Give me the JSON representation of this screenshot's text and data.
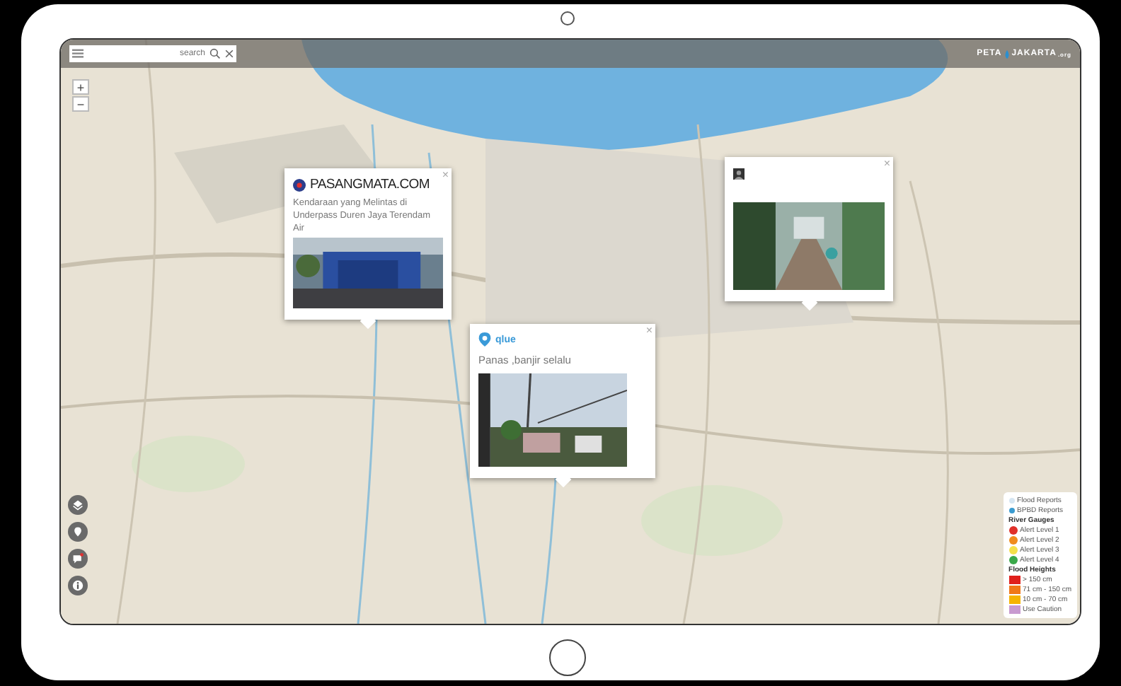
{
  "toolbar": {
    "search": {
      "placeholder": "search"
    },
    "brand": {
      "left": "PETA",
      "right": "JAKARTA",
      "suffix": ".org"
    }
  },
  "zoom": {
    "in": "+",
    "out": "−"
  },
  "popups": [
    {
      "kind": "pasangmata",
      "source": "PASANGMATA.COM",
      "text": "Kendaraan yang Melintas di Underpass Duren Jaya Terendam Air",
      "close": "×"
    },
    {
      "kind": "tweet",
      "close": "×"
    },
    {
      "kind": "qlue",
      "source": "qlue",
      "text": "Panas ,banjir selalu",
      "close": "×"
    }
  ],
  "legend": [
    {
      "kind": "report",
      "label": "Flood Reports",
      "color": "#d6e6f2"
    },
    {
      "kind": "report",
      "label": "BPBD Reports",
      "color": "#3a9bd0"
    },
    {
      "kind": "heading",
      "label": "River Gauges"
    },
    {
      "kind": "gauge",
      "label": "Alert Level 1",
      "color": "#e0302a"
    },
    {
      "kind": "gauge",
      "label": "Alert Level 2",
      "color": "#f08c1e"
    },
    {
      "kind": "gauge",
      "label": "Alert Level 3",
      "color": "#f5e04a"
    },
    {
      "kind": "gauge",
      "label": "Alert Level 4",
      "color": "#3aa84a"
    },
    {
      "kind": "heading",
      "label": "Flood Heights"
    },
    {
      "kind": "height",
      "label": "> 150 cm",
      "color": "#e0201c"
    },
    {
      "kind": "height",
      "label": "71 cm - 150 cm",
      "color": "#f07818"
    },
    {
      "kind": "height",
      "label": "10 cm - 70 cm",
      "color": "#f5b400"
    },
    {
      "kind": "height",
      "label": "Use Caution",
      "color": "#c89ad0"
    }
  ]
}
